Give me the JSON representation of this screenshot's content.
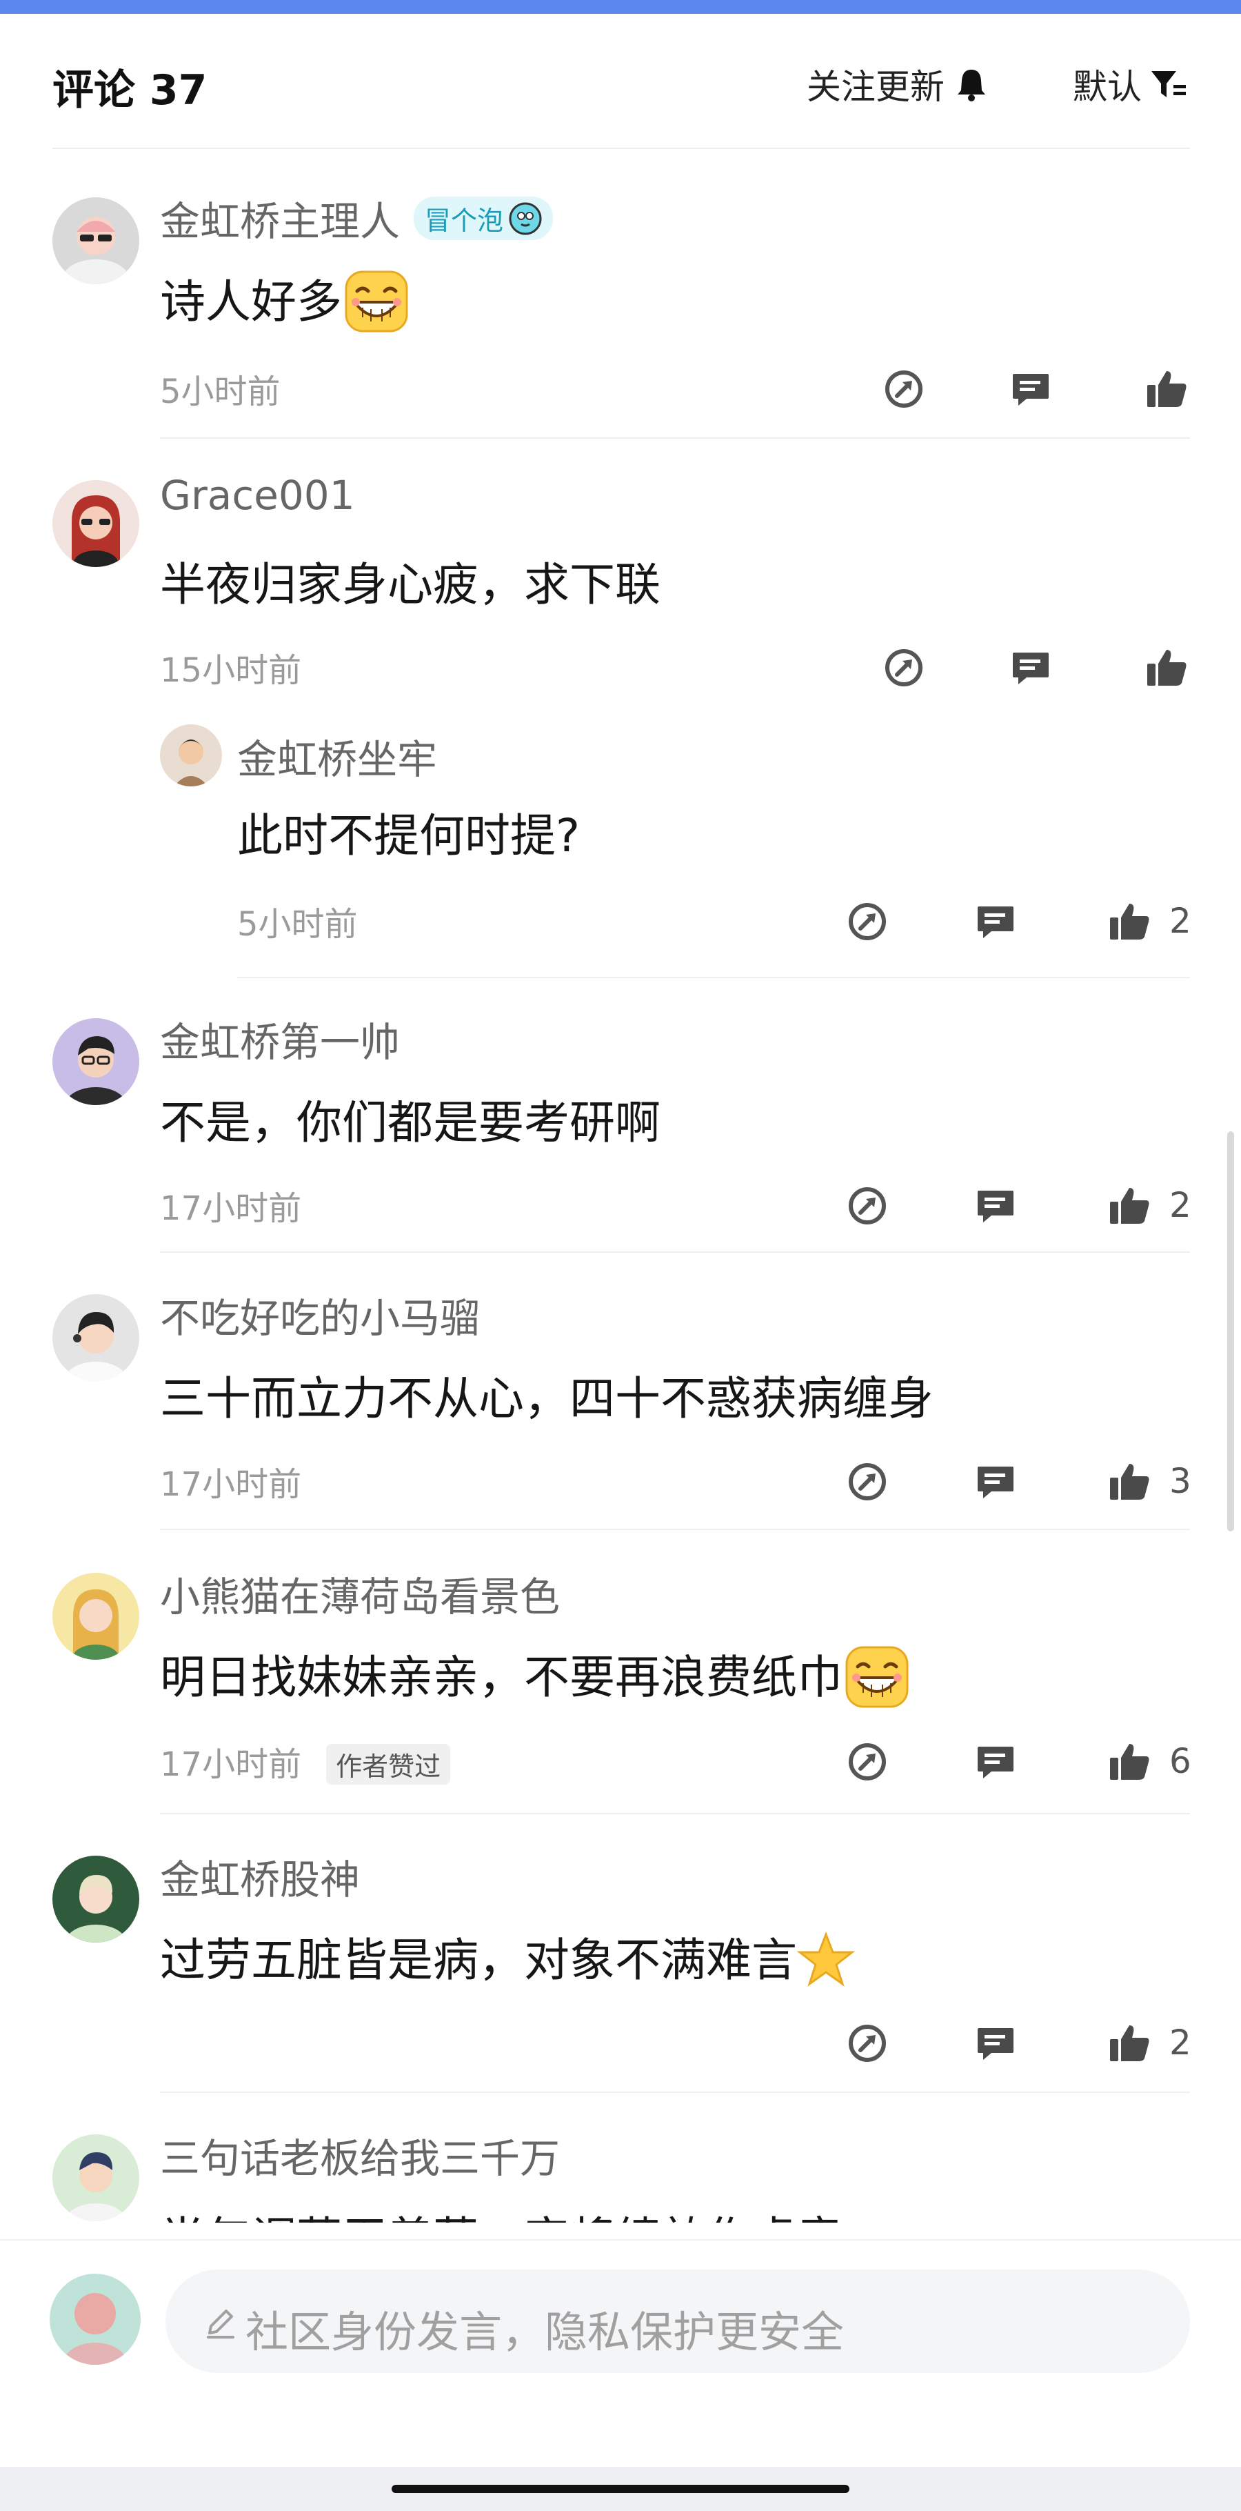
{
  "header": {
    "title": "评论 37",
    "follow_label": "关注更新",
    "sort_label": "默认"
  },
  "comments": [
    {
      "user": "金虹桥主理人",
      "badge": "冒个泡",
      "text": "诗人好多",
      "time": "5小时前"
    },
    {
      "user": "Grace001",
      "text": "半夜归家身心疲，求下联",
      "time": "15小时前",
      "reply": {
        "user": "金虹桥坐牢",
        "text": "此时不提何时提?",
        "time": "5小时前",
        "likes": "2"
      }
    },
    {
      "user": "金虹桥第一帅",
      "text": "不是，你们都是要考研啊",
      "time": "17小时前",
      "likes": "2"
    },
    {
      "user": "不吃好吃的小马骝",
      "text": "三十而立力不从心，四十不惑获病缠身",
      "time": "17小时前",
      "likes": "3"
    },
    {
      "user": "小熊猫在薄荷岛看景色",
      "text": "明日找妹妹亲亲，不要再浪费纸巾",
      "time": "17小时前",
      "tag": "作者赞过",
      "likes": "6"
    },
    {
      "user": "金虹桥股神",
      "text": "过劳五脏皆是病，对象不满难言",
      "likes": "2"
    },
    {
      "user": "三句话老板给我三千万",
      "text": "半年调薪无着落，突将绩效作虚章。"
    }
  ],
  "compose": {
    "placeholder": "社区身份发言，隐私保护更安全"
  },
  "icons": {
    "follow": "bell-icon",
    "sort": "filter-icon",
    "share": "share-icon",
    "reply": "comment-icon",
    "like": "thumbs-up-icon",
    "compose": "pen-icon"
  },
  "colors": {
    "accent_top_bar": "#5b86ec",
    "badge_bg": "#dff6fb",
    "badge_text": "#1a9db8"
  }
}
